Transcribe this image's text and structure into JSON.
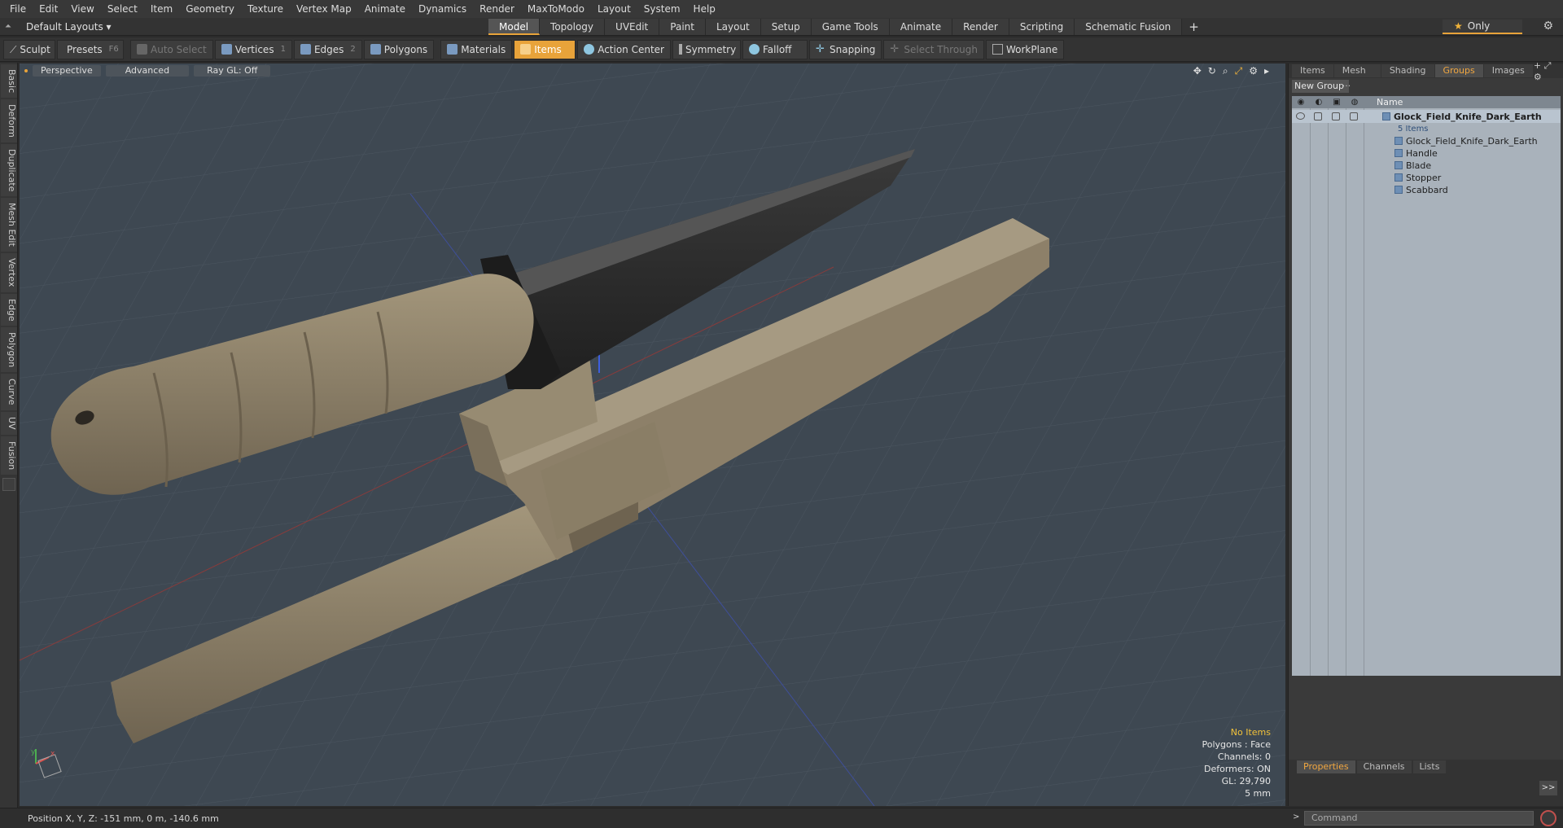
{
  "menu": [
    "File",
    "Edit",
    "View",
    "Select",
    "Item",
    "Geometry",
    "Texture",
    "Vertex Map",
    "Animate",
    "Dynamics",
    "Render",
    "MaxToModo",
    "Layout",
    "System",
    "Help"
  ],
  "layout": {
    "selector": "Default Layouts ▾",
    "tabs": [
      "Model",
      "Topology",
      "UVEdit",
      "Paint",
      "Layout",
      "Setup",
      "Game Tools",
      "Animate",
      "Render",
      "Scripting",
      "Schematic Fusion"
    ],
    "active_tab": "Model",
    "plus": "+",
    "only": "Only"
  },
  "toolbar": {
    "sculpt": "Sculpt",
    "presets": "Presets",
    "presets_key": "F6",
    "auto_select": "Auto Select",
    "vertices": "Vertices",
    "vertices_num": "1",
    "edges": "Edges",
    "edges_num": "2",
    "polygons": "Polygons",
    "materials": "Materials",
    "items": "Items",
    "action_center": "Action Center",
    "symmetry": "Symmetry",
    "falloff": "Falloff",
    "snapping": "Snapping",
    "select_through": "Select Through",
    "workplane": "WorkPlane"
  },
  "left_tabs": [
    "Basic",
    "Deform",
    "Duplicate",
    "Mesh Edit",
    "Vertex",
    "Edge",
    "Polygon",
    "Curve",
    "UV",
    "Fusion"
  ],
  "viewport": {
    "perspective": "Perspective",
    "advanced": "Advanced",
    "raygl": "Ray GL: Off",
    "info": {
      "items": "No Items",
      "polygons": "Polygons : Face",
      "channels": "Channels: 0",
      "deformers": "Deformers: ON",
      "gl": "GL: 29,790",
      "scale": "5 mm"
    }
  },
  "right_panel": {
    "tabs": [
      "Items",
      "Mesh ...",
      "Shading",
      "Groups",
      "Images"
    ],
    "active_tab": "Groups",
    "new_group": "New Group",
    "name_header": "Name",
    "root": {
      "name": "Glock_Field_Knife_Dark_Earth",
      "count": "5 Items"
    },
    "children": [
      "Glock_Field_Knife_Dark_Earth",
      "Handle",
      "Blade",
      "Stopper",
      "Scabbard"
    ],
    "bottom_tabs": [
      "Properties",
      "Channels",
      "Lists"
    ],
    "bottom_active": "Properties",
    "expand": ">>"
  },
  "status": {
    "position": "Position X, Y, Z:   -151 mm, 0 m, -140.6 mm",
    "command_placeholder": "Command"
  },
  "colors": {
    "accent": "#e8a33a",
    "viewport_bg": "#3e4852",
    "tan": "#8b7e66",
    "blade": "#2e2e2e"
  }
}
